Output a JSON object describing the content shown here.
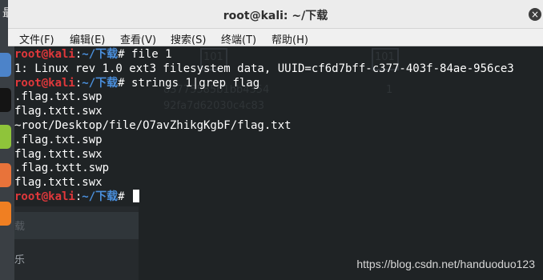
{
  "window": {
    "title": "root@kali: ~/下载",
    "close_icon": "×"
  },
  "desktop": {
    "top_fragment": "最"
  },
  "menu": [
    {
      "label": "文件(F)"
    },
    {
      "label": "编辑(E)"
    },
    {
      "label": "查看(V)"
    },
    {
      "label": "搜索(S)"
    },
    {
      "label": "终端(T)"
    },
    {
      "label": "帮助(H)"
    }
  ],
  "terminal": {
    "prompt_user": "root@kali",
    "prompt_path": "~/下载",
    "prompt_symbol": "#",
    "lines": [
      {
        "type": "cmd",
        "text": " file 1"
      },
      {
        "type": "out",
        "text": "1: Linux rev 1.0 ext3 filesystem data, UUID=cf6d7bff-c377-403f-84ae-956ce3"
      },
      {
        "type": "cmd",
        "text": " strings 1|grep flag"
      },
      {
        "type": "out",
        "text": ".flag.txt.swp"
      },
      {
        "type": "out",
        "text": "flag.txtt.swx"
      },
      {
        "type": "out",
        "text": "~root/Desktop/file/O7avZhikgKgbF/flag.txt"
      },
      {
        "type": "out",
        "text": ".flag.txt.swp"
      },
      {
        "type": "out",
        "text": "flag.txtt.swx"
      },
      {
        "type": "out",
        "text": ".flag.txtt.swp"
      },
      {
        "type": "out",
        "text": "flag.txtt.swx"
      },
      {
        "type": "cmd",
        "text": " "
      }
    ],
    "ghost": {
      "hash1": "83775585b1bb4354",
      "hash2": "92fa7d62030c4c83",
      "num": "1",
      "icon_text": "101"
    }
  },
  "background_pane": {
    "item1": "载",
    "item2": "乐"
  },
  "watermark": "https://blog.csdn.net/handuoduo123",
  "colors": {
    "prompt_user": "#e0383b",
    "prompt_path": "#4a8fdc",
    "terminal_bg": "#1f2325",
    "text": "#ffffff"
  }
}
